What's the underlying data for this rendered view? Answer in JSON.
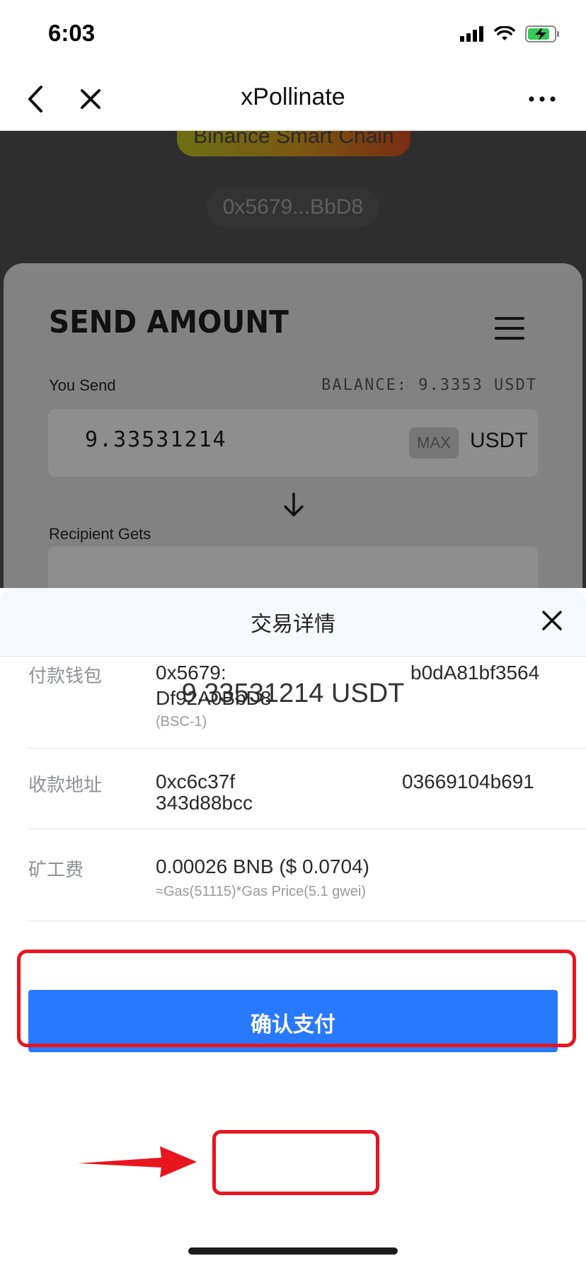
{
  "status": {
    "time": "6:03"
  },
  "nav": {
    "title": "xPollinate"
  },
  "dapp": {
    "chain": "Binance Smart Chain",
    "address": "0x5679...BbD8",
    "send_title": "SEND AMOUNT",
    "you_send_label": "You Send",
    "balance": "BALANCE: 9.3353 USDT",
    "send_value": "9.33531214",
    "max_label": "MAX",
    "currency": "USDT",
    "recipient_label": "Recipient Gets"
  },
  "sheet": {
    "title": "交易详情",
    "amount": "9.33531214 USDT",
    "pay_wallet_label": "付款钱包",
    "pay_wallet_line1_a": "0x5679:",
    "pay_wallet_line1_b": "b0dA81bf3564",
    "pay_wallet_line2": "Df92A0BbD8",
    "pay_wallet_network": "(BSC-1)",
    "recv_label": "收款地址",
    "recv_line1_a": "0xc6c37f",
    "recv_line1_b": "03669104b691",
    "recv_line2": "343d88bcc",
    "fee_label": "矿工费",
    "fee_value": "0.00026 BNB ($ 0.0704)",
    "fee_detail": "≈Gas(51115)*Gas Price(5.1 gwei)",
    "confirm_label": "确认支付"
  },
  "colors": {
    "accent": "#2979ff",
    "annotation": "#e8141e"
  }
}
